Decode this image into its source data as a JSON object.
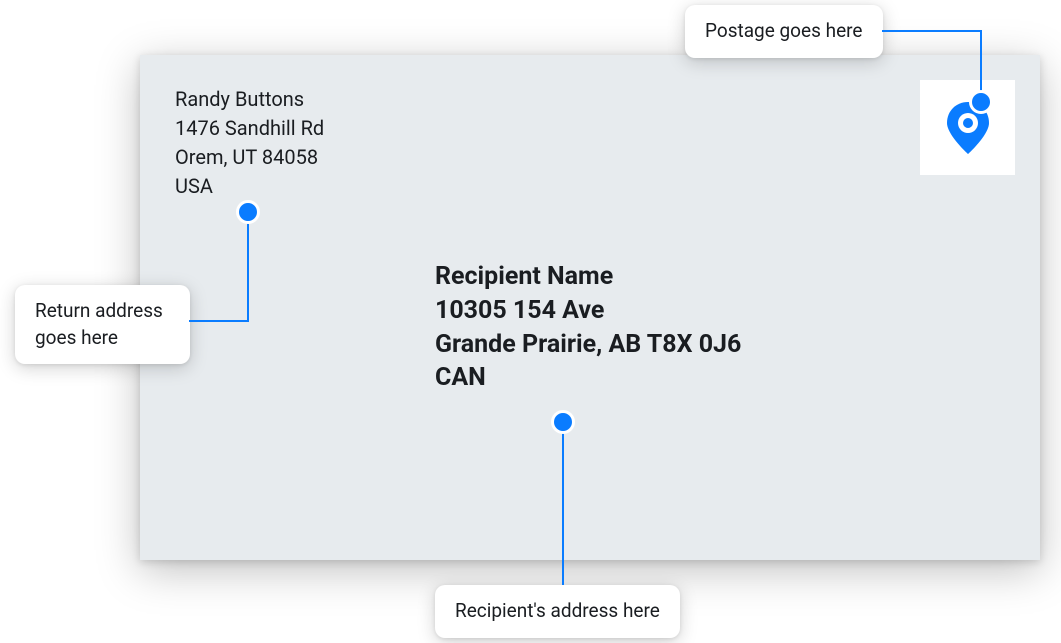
{
  "return_address": {
    "name": "Randy Buttons",
    "street": "1476 Sandhill Rd",
    "city_state_zip": "Orem, UT 84058",
    "country": "USA"
  },
  "recipient_address": {
    "name": "Recipient Name",
    "street": "10305 154 Ave",
    "city_province_postal": "Grande Prairie, AB T8X 0J6",
    "country": "CAN"
  },
  "callouts": {
    "postage": "Postage goes here",
    "return": "Return address goes here",
    "recipient": "Recipient's address here"
  },
  "colors": {
    "accent": "#0a7cff",
    "envelope": "#e7ebee",
    "text": "#1a1d21"
  }
}
